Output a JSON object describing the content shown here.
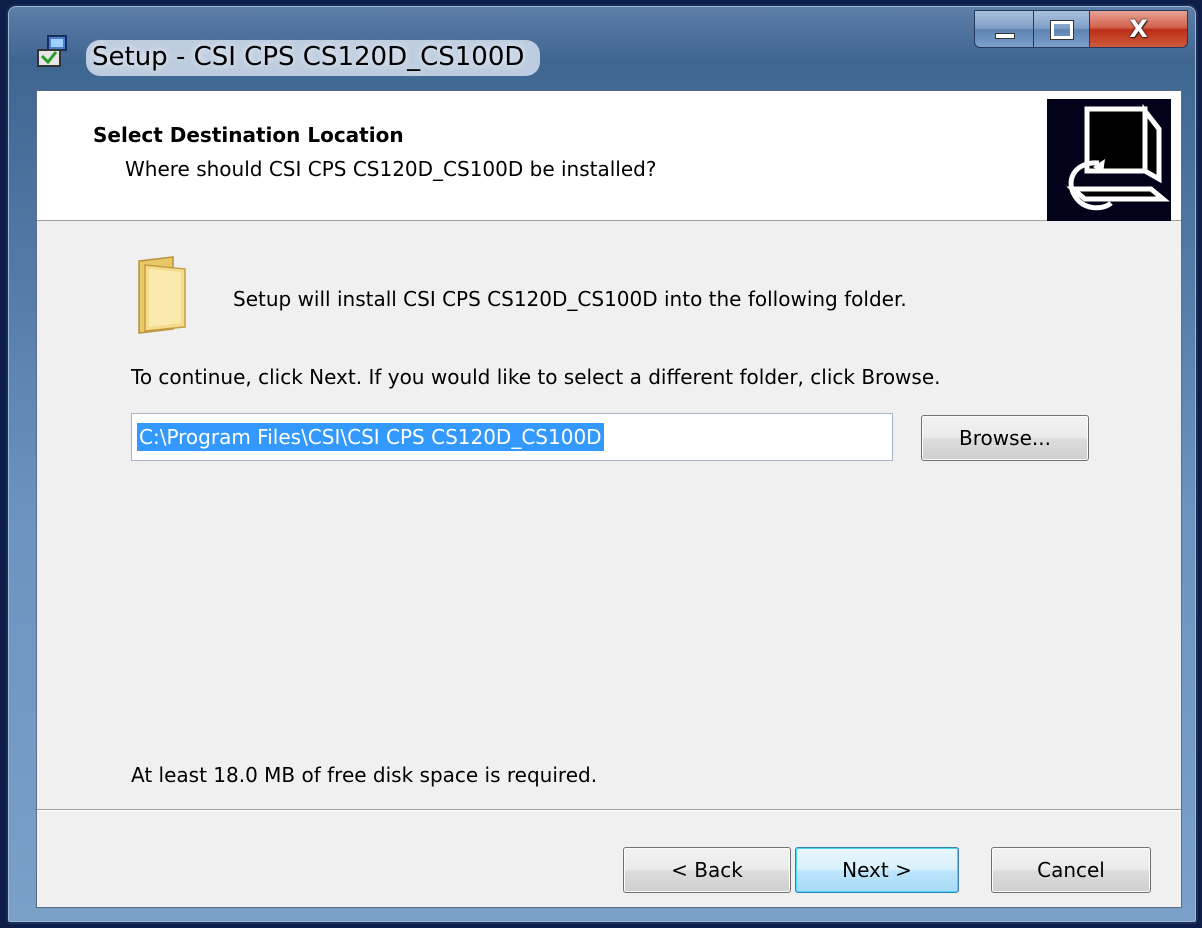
{
  "window": {
    "title": "Setup - CSI CPS CS120D_CS100D",
    "close_glyph": "X"
  },
  "header": {
    "title": "Select Destination Location",
    "subtitle": "Where should CSI CPS CS120D_CS100D be installed?"
  },
  "body": {
    "intro": "Setup will install CSI CPS CS120D_CS100D into the following folder.",
    "instructions": "To continue, click Next. If you would like to select a different folder, click Browse.",
    "install_path": "C:\\Program Files\\CSI\\CSI CPS CS120D_CS100D",
    "disk_space": "At least 18.0 MB of free disk space is required."
  },
  "buttons": {
    "browse": "Browse...",
    "back": "< Back",
    "next": "Next >",
    "cancel": "Cancel"
  },
  "icons": {
    "title": "setup-app-icon",
    "wizard": "computer-install-icon",
    "folder": "folder-icon"
  },
  "colors": {
    "selection": "#3399ff",
    "client_bg": "#f0f0f0",
    "header_bg": "#ffffff"
  }
}
